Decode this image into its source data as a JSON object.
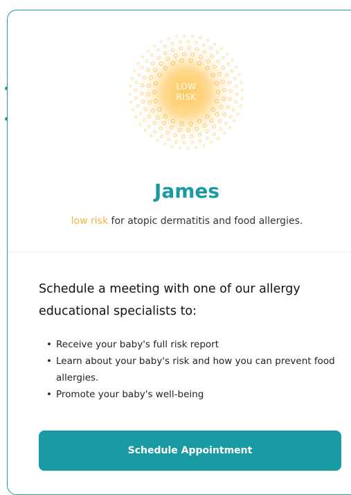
{
  "badge": {
    "line1": "LOW",
    "line2": "RISK"
  },
  "child_name": "James",
  "summary": {
    "risk_label": "low risk",
    "text": " for atopic dermatitis and food allergies."
  },
  "schedule": {
    "heading": "Schedule a meeting with one of our allergy educational specialists to:",
    "bullets": [
      "Receive your baby's full risk report",
      "Learn about your baby's risk and how you can prevent food allergies.",
      "Promote your baby's well-being"
    ],
    "button_label": "Schedule Appointment"
  },
  "colors": {
    "accent": "#1a9aa3",
    "risk": "#f3b23f",
    "badge_glow": "#ffc860"
  },
  "icons": [
    "low-risk-sunburst-icon"
  ]
}
